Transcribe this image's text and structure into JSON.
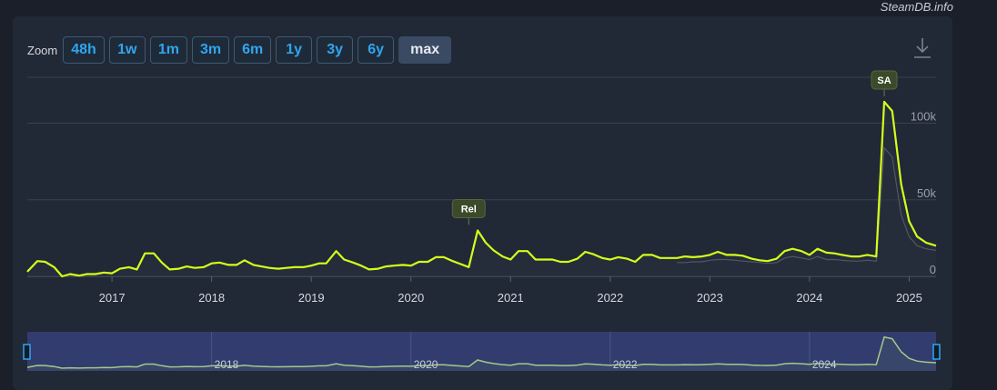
{
  "watermark": "SteamDB.info",
  "zoom": {
    "label": "Zoom",
    "buttons": [
      "48h",
      "1w",
      "1m",
      "3m",
      "6m",
      "1y",
      "3y",
      "6y",
      "max"
    ],
    "active": "max"
  },
  "colors": {
    "primary_line": "#d4ff1a",
    "secondary_line": "#8c8f96",
    "navigator_line": "#a3c98a",
    "flag_fill": "#3b4a2a"
  },
  "chart_data": {
    "type": "line",
    "xlim": [
      2016.15,
      2025.27
    ],
    "ylim": [
      0,
      130000
    ],
    "y_ticks": [
      0,
      50000,
      100000
    ],
    "y_tick_labels": [
      "0",
      "50k",
      "100k"
    ],
    "x_tick_labels": [
      "2017",
      "2018",
      "2019",
      "2020",
      "2021",
      "2022",
      "2023",
      "2024",
      "2025"
    ],
    "x_tick_values": [
      2017,
      2018,
      2019,
      2020,
      2021,
      2022,
      2023,
      2024,
      2025
    ],
    "grid": true,
    "series": [
      {
        "x": [
          2016.15,
          2016.25,
          2016.33,
          2016.42,
          2016.5,
          2016.58,
          2016.67,
          2016.75,
          2016.83,
          2016.92,
          2017.0,
          2017.08,
          2017.17,
          2017.25,
          2017.33,
          2017.42,
          2017.5,
          2017.58,
          2017.67,
          2017.75,
          2017.83,
          2017.92,
          2018.0,
          2018.08,
          2018.17,
          2018.25,
          2018.33,
          2018.42,
          2018.5,
          2018.58,
          2018.67,
          2018.75,
          2018.83,
          2018.92,
          2019.0,
          2019.08,
          2019.15,
          2019.25,
          2019.33,
          2019.42,
          2019.5,
          2019.58,
          2019.67,
          2019.75,
          2019.83,
          2019.92,
          2020.0,
          2020.08,
          2020.17,
          2020.25,
          2020.33,
          2020.42,
          2020.5,
          2020.58,
          2020.67,
          2020.75,
          2020.83,
          2020.92,
          2021.0,
          2021.08,
          2021.17,
          2021.25,
          2021.33,
          2021.42,
          2021.5,
          2021.58,
          2021.67,
          2021.75,
          2021.83,
          2021.92,
          2022.0,
          2022.08,
          2022.17,
          2022.25,
          2022.33,
          2022.42,
          2022.5,
          2022.58,
          2022.67,
          2022.75,
          2022.83,
          2022.92,
          2023.0,
          2023.08,
          2023.17,
          2023.25,
          2023.33,
          2023.42,
          2023.5,
          2023.58,
          2023.67,
          2023.75,
          2023.83,
          2023.92,
          2024.0,
          2024.08,
          2024.17,
          2024.25,
          2024.33,
          2024.42,
          2024.5,
          2024.58,
          2024.67,
          2024.75,
          2024.83,
          2024.92,
          2025.0,
          2025.08,
          2025.17,
          2025.27
        ],
        "y": [
          3000,
          10000,
          9500,
          6000,
          0,
          1500,
          500,
          1500,
          1500,
          2500,
          2000,
          5000,
          6000,
          4500,
          15000,
          15000,
          9000,
          4500,
          5000,
          6500,
          5500,
          6000,
          8500,
          9000,
          7500,
          7500,
          10500,
          7500,
          6500,
          5500,
          5000,
          5500,
          6000,
          6000,
          7000,
          8500,
          8500,
          16500,
          11000,
          9000,
          7000,
          4500,
          5000,
          6500,
          7000,
          7500,
          7000,
          9500,
          9500,
          12500,
          12500,
          10000,
          8000,
          6000,
          30000,
          22000,
          17000,
          13000,
          11000,
          16500,
          16500,
          11000,
          11000,
          11000,
          9500,
          9500,
          11500,
          16000,
          14500,
          12000,
          11000,
          12500,
          11500,
          9500,
          14000,
          14000,
          12000,
          12000,
          12000,
          13000,
          12500,
          13000,
          14000,
          16000,
          14000,
          14000,
          13500,
          11500,
          10500,
          10000,
          11500,
          16500,
          18000,
          16500,
          14000,
          18000,
          15500,
          15000,
          14000,
          13000,
          13000,
          14000,
          13000,
          114000,
          108000,
          60000,
          36000,
          26000,
          22000,
          20000
        ]
      },
      {
        "x": [
          2022.67,
          2022.75,
          2022.83,
          2022.92,
          2023.0,
          2023.08,
          2023.17,
          2023.25,
          2023.33,
          2023.42,
          2023.5,
          2023.58,
          2023.67,
          2023.75,
          2023.83,
          2023.92,
          2024.0,
          2024.08,
          2024.17,
          2024.25,
          2024.33,
          2024.42,
          2024.5,
          2024.58,
          2024.67,
          2024.75,
          2024.83,
          2024.92,
          2025.0,
          2025.08,
          2025.17,
          2025.27
        ],
        "y": [
          9000,
          9000,
          9500,
          9500,
          10500,
          11000,
          11000,
          10500,
          10000,
          9500,
          9000,
          8500,
          9000,
          12000,
          13000,
          12000,
          11000,
          13000,
          11000,
          11000,
          10500,
          10000,
          10000,
          10500,
          10000,
          84000,
          78000,
          40000,
          26000,
          20000,
          18000,
          17000
        ]
      }
    ],
    "flags": [
      {
        "label": "Rel",
        "x": 2020.58,
        "y": 30000
      },
      {
        "label": "SA",
        "x": 2024.75,
        "y": 114000
      }
    ],
    "navigator": {
      "xlim": [
        2016.15,
        2025.27
      ],
      "year_labels": [
        "2018",
        "2020",
        "2022",
        "2024"
      ],
      "year_values": [
        2018,
        2020,
        2022,
        2024
      ]
    }
  }
}
